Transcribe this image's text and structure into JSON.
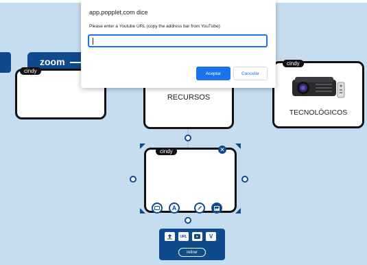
{
  "dialog": {
    "origin": "app.popplet.com dice",
    "message": "Please enter a Youtube URL (copy the address bar from YouTube):",
    "input_value": "",
    "accept_label": "Aceptar",
    "cancel_label": "Cancelar"
  },
  "canvas": {
    "zoom_label": "zoom",
    "cards": {
      "left": {
        "user": "cindy",
        "text": ""
      },
      "center": {
        "user": "",
        "text": "RECURSOS"
      },
      "right": {
        "user": "cindy",
        "text": "TECNOLÓGICOS",
        "image_icon": "projector-image"
      },
      "selected": {
        "user": "cindy",
        "text": ""
      }
    },
    "toolbar_icons": [
      "frame-icon",
      "text-icon",
      "pencil-icon",
      "image-icon"
    ],
    "media": {
      "buttons": [
        "upload-icon",
        "URL",
        "youtube-icon",
        "vimeo-icon"
      ],
      "remove_label": "retirar"
    }
  },
  "colors": {
    "background": "#c6dcef",
    "brand": "#0f4a8c",
    "dialog_primary": "#1a73e8"
  }
}
